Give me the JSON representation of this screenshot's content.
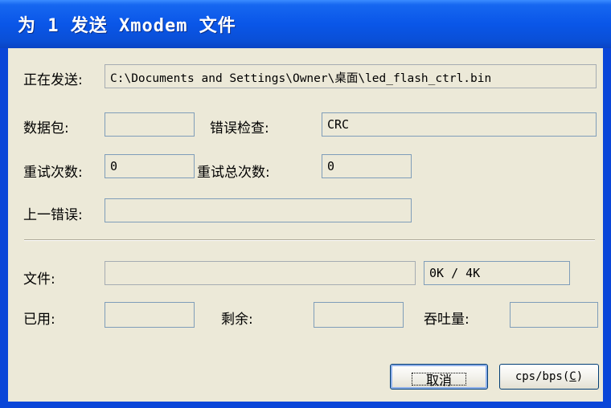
{
  "window": {
    "title": "为 1 发送 Xmodem 文件"
  },
  "sending": {
    "label": "正在发送:",
    "path": "C:\\Documents and Settings\\Owner\\桌面\\led_flash_ctrl.bin"
  },
  "packet": {
    "label": "数据包:",
    "value": ""
  },
  "error_check": {
    "label": "错误检查:",
    "value": "CRC"
  },
  "retries": {
    "label": "重试次数:",
    "value": "0"
  },
  "total_retries": {
    "label": "重试总次数:",
    "value": "0"
  },
  "last_error": {
    "label": "上一错误:",
    "value": ""
  },
  "file": {
    "label": "文件:",
    "progress_fraction": 0,
    "size_text": "0K / 4K"
  },
  "elapsed": {
    "label": "已用:",
    "value": ""
  },
  "remaining": {
    "label": "剩余:",
    "value": ""
  },
  "throughput": {
    "label": "吞吐量:",
    "value": ""
  },
  "buttons": {
    "cancel": "取消",
    "cps_bps": "cps/bps",
    "cps_bps_mnemonic": "C"
  },
  "colors": {
    "titlebar": "#0a56e8",
    "dialog_bg": "#ece9d8",
    "field_border": "#7f9db9"
  }
}
